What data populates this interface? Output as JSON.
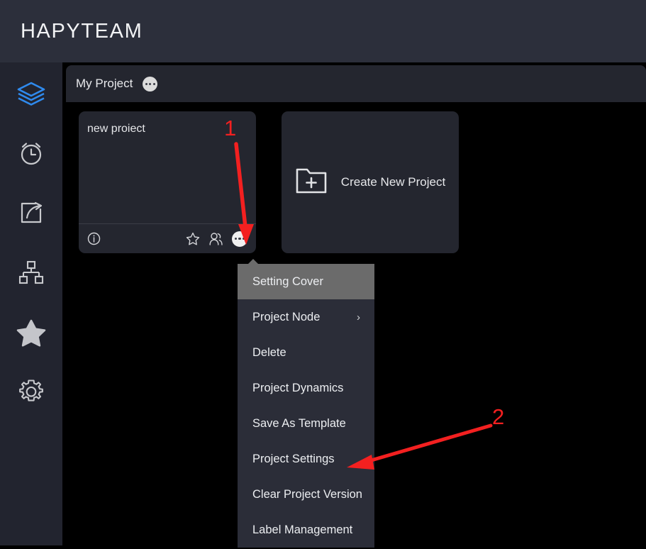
{
  "app": {
    "brand_title": "HAPYTEAM",
    "background_color": "#000000",
    "header_color": "#2c2f3b",
    "panel_color": "#24262f",
    "accent_color": "#2f8aee",
    "annotation_color": "#f32020"
  },
  "sidebar": {
    "items": [
      {
        "name": "layers",
        "icon": "layers-icon",
        "active": true
      },
      {
        "name": "alarm",
        "icon": "alarm-clock-icon",
        "active": false
      },
      {
        "name": "share",
        "icon": "share-export-icon",
        "active": false
      },
      {
        "name": "hierarchy",
        "icon": "org-chart-icon",
        "active": false
      },
      {
        "name": "favorites",
        "icon": "star-filled-icon",
        "active": false
      },
      {
        "name": "settings",
        "icon": "gear-icon",
        "active": false
      }
    ]
  },
  "workspace": {
    "title": "My Project",
    "more_icon": "ellipsis-icon"
  },
  "projects": {
    "cards": [
      {
        "name": "new proiect",
        "footer_icons": [
          "info-circle-icon",
          "star-outline-icon",
          "members-icon",
          "ellipsis-icon"
        ]
      }
    ],
    "create_card": {
      "label": "Create New Project",
      "icon": "folder-plus-icon"
    }
  },
  "context_menu": {
    "items": [
      {
        "label": "Setting Cover",
        "highlighted": true,
        "has_submenu": false
      },
      {
        "label": "Project Node",
        "highlighted": false,
        "has_submenu": true,
        "chevron": "›"
      },
      {
        "label": "Delete",
        "highlighted": false,
        "has_submenu": false
      },
      {
        "label": "Project Dynamics",
        "highlighted": false,
        "has_submenu": false
      },
      {
        "label": "Save As Template",
        "highlighted": false,
        "has_submenu": false
      },
      {
        "label": "Project Settings",
        "highlighted": false,
        "has_submenu": false
      },
      {
        "label": "Clear Project Version",
        "highlighted": false,
        "has_submenu": false
      },
      {
        "label": "Label Management",
        "highlighted": false,
        "has_submenu": false
      }
    ]
  },
  "annotations": [
    {
      "number": "1",
      "points_to": "card-more-button"
    },
    {
      "number": "2",
      "points_to": "menu-item-project-settings"
    }
  ]
}
